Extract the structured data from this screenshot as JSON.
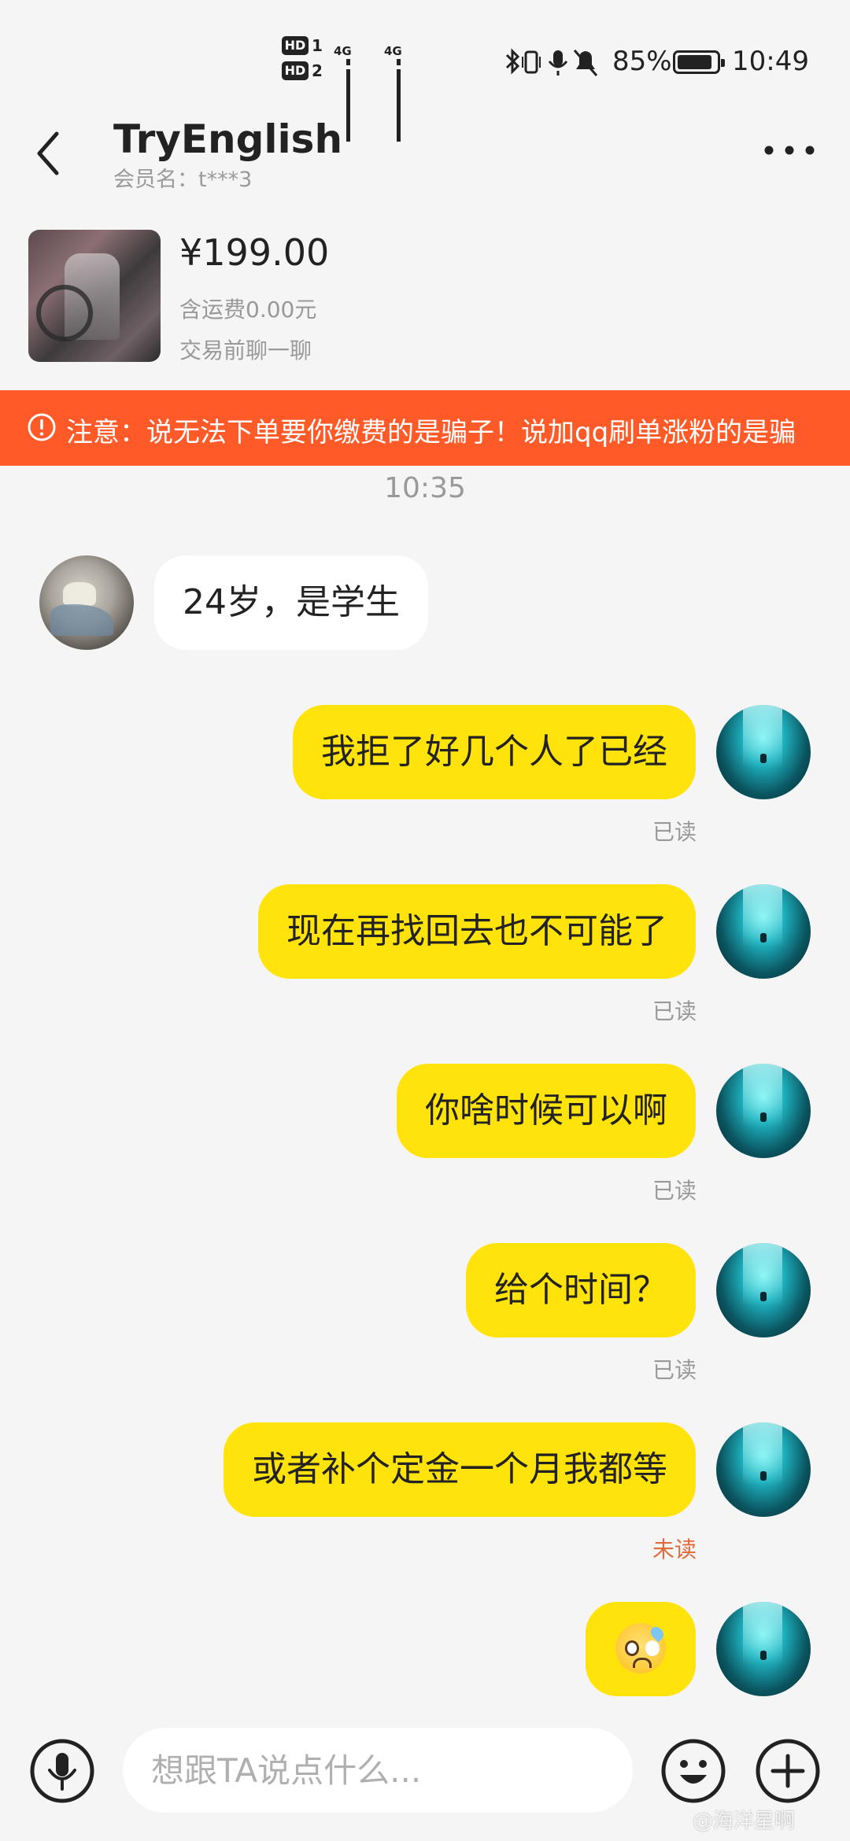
{
  "status_bar": {
    "hd1": "HD",
    "hd1_num": "1",
    "hd2": "HD",
    "hd2_num": "2",
    "sig1_tag": "4G",
    "sig2_tag": "4G",
    "battery": "85%",
    "time": "10:49"
  },
  "header": {
    "title": "TryEnglish",
    "member": "会员名：t***3"
  },
  "product": {
    "price": "¥199.00",
    "shipping": "含运费0.00元",
    "chat_hint": "交易前聊一聊"
  },
  "warning": {
    "text": "注意：说无法下单要你缴费的是骗子！说加qq刷单涨粉的是骗"
  },
  "chat": {
    "time_separator": "10:35",
    "messages": [
      {
        "from": "other",
        "text": "24岁，是学生"
      },
      {
        "from": "self",
        "text": "我拒了好几个人了已经",
        "status": "已读"
      },
      {
        "from": "self",
        "text": "现在再找回去也不可能了",
        "status": "已读"
      },
      {
        "from": "self",
        "text": "你啥时候可以啊",
        "status": "已读"
      },
      {
        "from": "self",
        "text": "给个时间？",
        "status": "已读"
      },
      {
        "from": "self",
        "text": "或者补个定金一个月我都等",
        "status": "未读"
      },
      {
        "from": "self",
        "emoji": "sweat-smile-face-icon"
      }
    ]
  },
  "input": {
    "placeholder": "想跟TA说点什么..."
  },
  "watermark": "@海洋星啊",
  "colors": {
    "self_bubble": "#ffe30a",
    "warning_bg": "#ff5a27",
    "unread": "#e06a3a"
  }
}
